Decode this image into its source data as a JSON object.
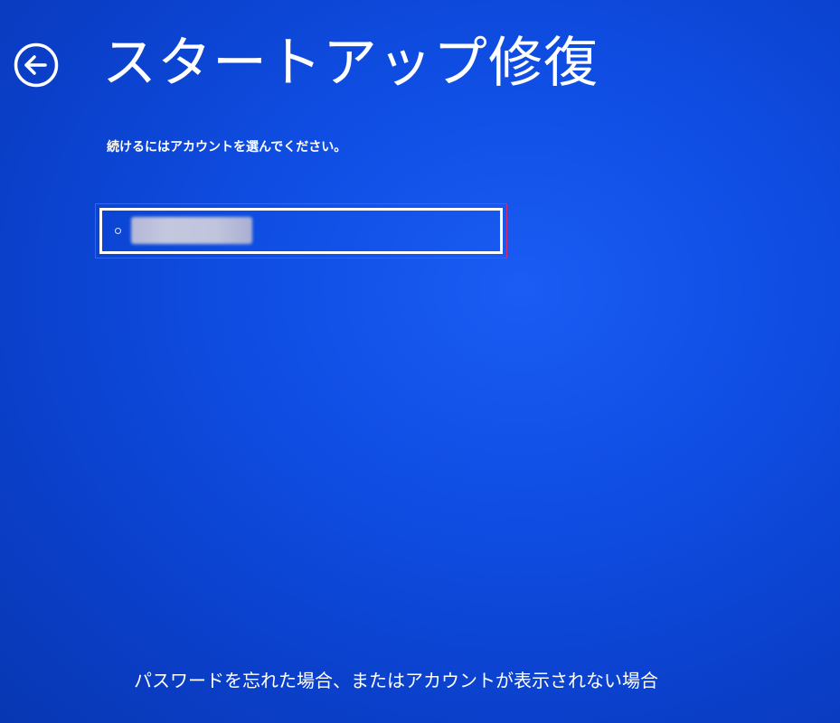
{
  "header": {
    "back_icon": "back-arrow-circle-icon",
    "title": "スタートアップ修復"
  },
  "main": {
    "instruction": "続けるにはアカウントを選んでください。",
    "accounts": [
      {
        "selected": true,
        "name_redacted": true
      }
    ]
  },
  "footer": {
    "forgot_link": "パスワードを忘れた場合、またはアカウントが表示されない場合"
  },
  "colors": {
    "background": "#0f4de2",
    "foreground": "#ffffff",
    "highlight_frame": "#d92a6c"
  }
}
